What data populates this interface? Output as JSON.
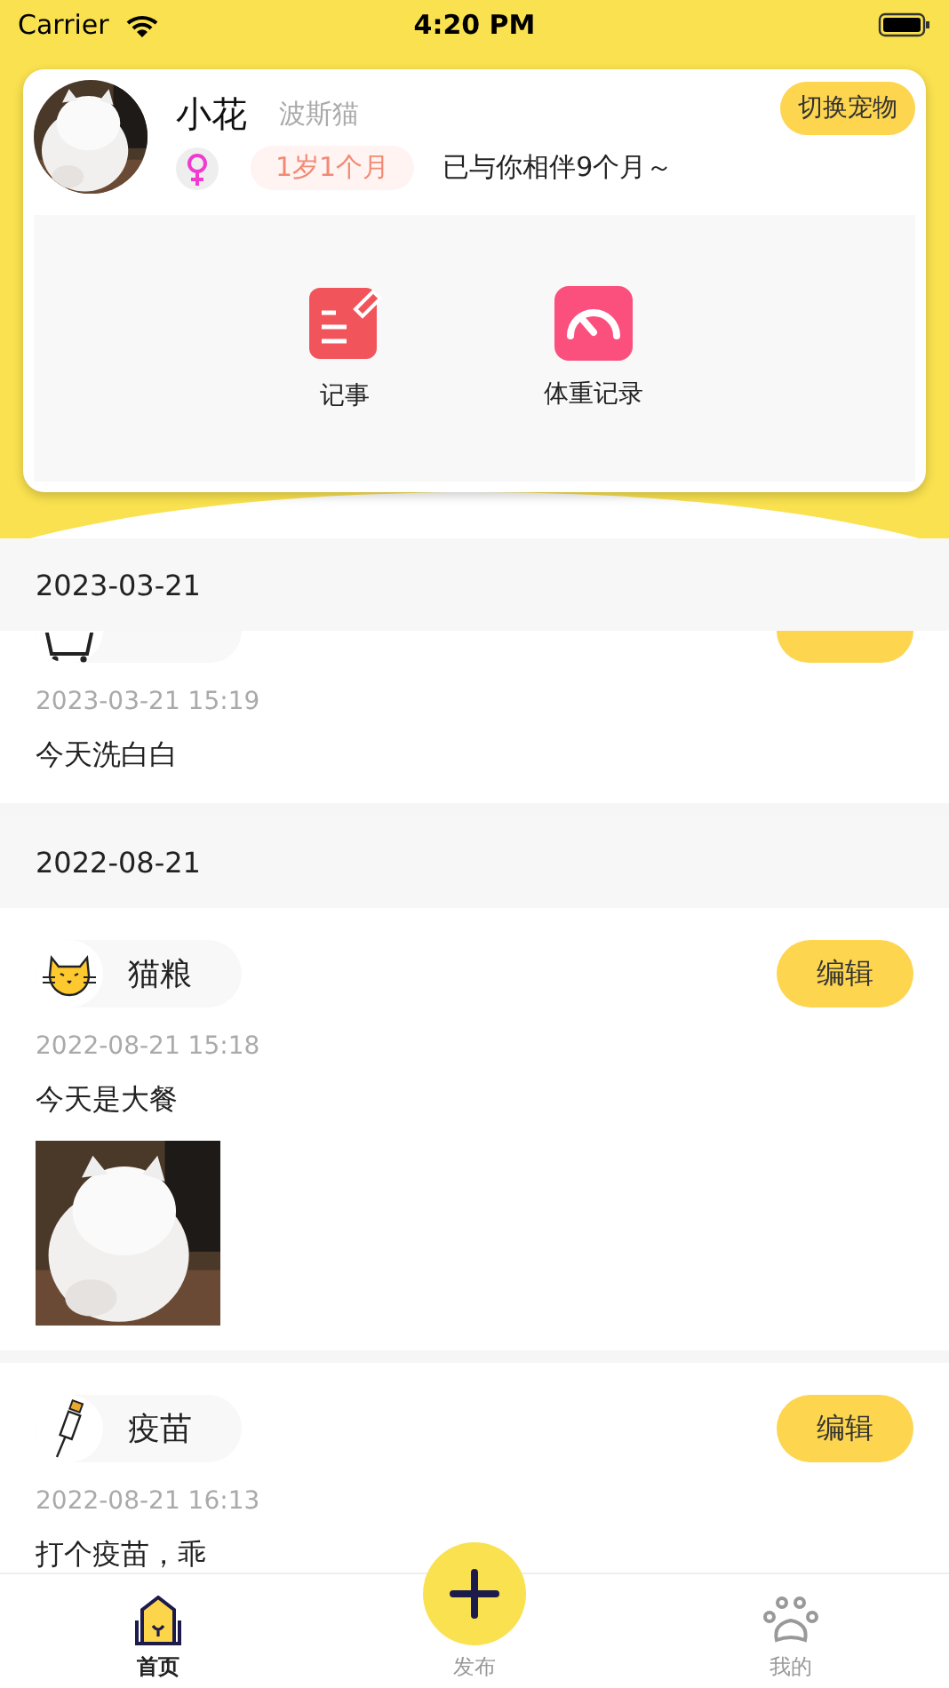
{
  "status_bar": {
    "carrier": "Carrier",
    "time": "4:20 PM"
  },
  "pet": {
    "name": "小花",
    "breed": "波斯猫",
    "age": "1岁1个月",
    "companion": "已与你相伴9个月～",
    "switch_button": "切换宠物"
  },
  "shortcuts": [
    {
      "label": "记事",
      "kind": "note"
    },
    {
      "label": "体重记录",
      "kind": "weight"
    }
  ],
  "sections": [
    {
      "date": "2023-03-21",
      "entries": [
        {
          "kind": "bath",
          "clipped": true,
          "time": "2023-03-21 15:19",
          "text": "今天洗白白"
        }
      ]
    },
    {
      "date": "2022-08-21",
      "entries": [
        {
          "kind": "food",
          "tag": "猫粮",
          "edit": "编辑",
          "time": "2022-08-21 15:18",
          "text": "今天是大餐"
        },
        {
          "kind": "vaccine",
          "tag": "疫苗",
          "edit": "编辑",
          "time": "2022-08-21 16:13",
          "text": "打个疫苗，乖"
        }
      ]
    }
  ],
  "tabs": [
    {
      "label": "首页",
      "kind": "home",
      "selected": true
    },
    {
      "label": "发布",
      "kind": "publish",
      "selected": false
    },
    {
      "label": "我的",
      "kind": "paw",
      "selected": false
    }
  ]
}
